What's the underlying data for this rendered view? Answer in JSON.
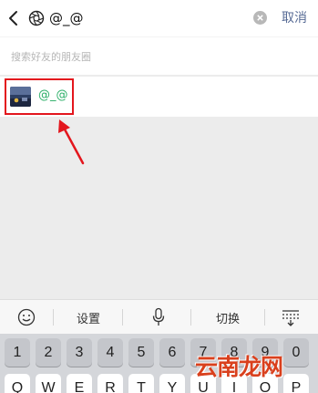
{
  "search": {
    "query": "@_@",
    "cancel_label": "取消",
    "hint": "搜索好友的朋友圈"
  },
  "result": {
    "name": "@_@"
  },
  "annotation": {
    "highlight_color": "#e3161d"
  },
  "keyboard": {
    "toolbar": {
      "emoji_icon": "smiley-icon",
      "settings_label": "设置",
      "mic_icon": "microphone-icon",
      "switch_label": "切换",
      "collapse_icon": "keyboard-collapse-icon"
    },
    "number_row": [
      "1",
      "2",
      "3",
      "4",
      "5",
      "6",
      "7",
      "8",
      "9",
      "0"
    ],
    "letter_row": [
      "Q",
      "W",
      "E",
      "R",
      "T",
      "Y",
      "U",
      "I",
      "O",
      "P"
    ]
  },
  "watermark": "云南龙网",
  "colors": {
    "link_blue": "#576b95",
    "result_green": "#2aae67",
    "watermark_red": "#d9401d"
  }
}
